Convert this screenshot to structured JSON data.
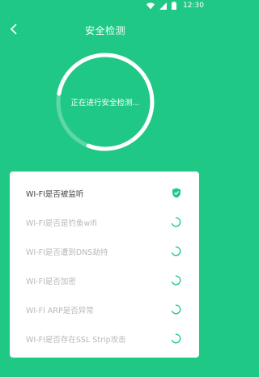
{
  "status_bar": {
    "time": "12:30",
    "icons": [
      "wifi-icon",
      "signal-icon",
      "battery-icon"
    ]
  },
  "header": {
    "back_icon": "back-arrow-icon",
    "title": "安全检测"
  },
  "progress": {
    "text": "正在进行安全检测...",
    "fraction": 0.22,
    "track_color": "#5dd7a6",
    "arc_color": "#ffffff"
  },
  "checks": [
    {
      "label": "WI-FI是否被监听",
      "status": "done"
    },
    {
      "label": "WI-FI是否是钓鱼wifi",
      "status": "loading"
    },
    {
      "label": "WI-FI是否遭到DNS劫持",
      "status": "loading"
    },
    {
      "label": "WI-FI是否加密",
      "status": "loading"
    },
    {
      "label": "WI-FI ARP是否异常",
      "status": "loading"
    },
    {
      "label": "WI-FI是否存在SSL Strip攻击",
      "status": "loading"
    }
  ],
  "colors": {
    "background": "#20c885",
    "accent": "#20c885",
    "card": "#ffffff"
  }
}
